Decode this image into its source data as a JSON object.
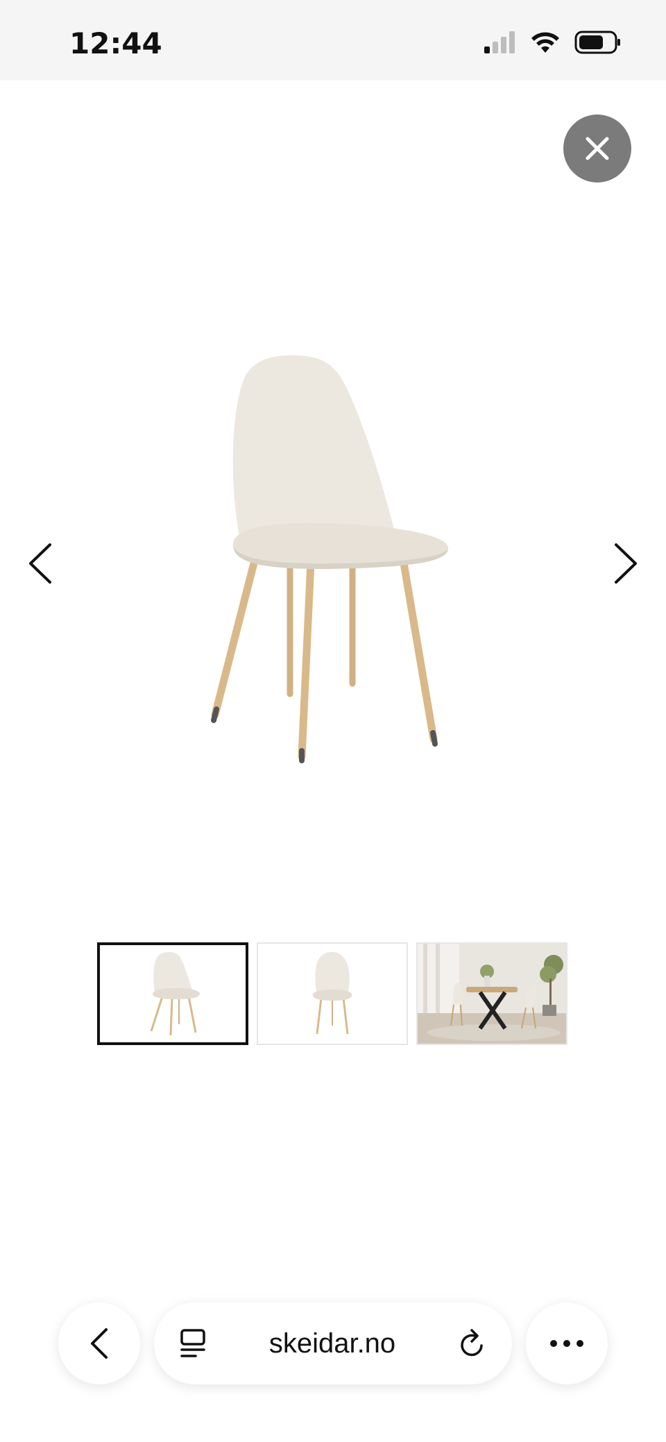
{
  "status_bar": {
    "time": "12:44"
  },
  "viewer": {
    "close_icon": "close-icon",
    "prev_icon": "chevron-left-icon",
    "next_icon": "chevron-right-icon",
    "thumbnails": [
      {
        "id": "thumb-1",
        "selected": true
      },
      {
        "id": "thumb-2",
        "selected": false
      },
      {
        "id": "thumb-3",
        "selected": false
      }
    ]
  },
  "browser": {
    "url": "skeidar.no",
    "back_icon": "chevron-left-icon",
    "tabs_icon": "page-icon",
    "reload_icon": "reload-icon",
    "more_icon": "more-icon"
  },
  "colors": {
    "status_bg": "#f5f5f5",
    "close_bg": "#7b7b7b",
    "chair_fabric": "#ece7df",
    "chair_legs": "#d9b98a",
    "selected_thumb_border": "#111111"
  }
}
